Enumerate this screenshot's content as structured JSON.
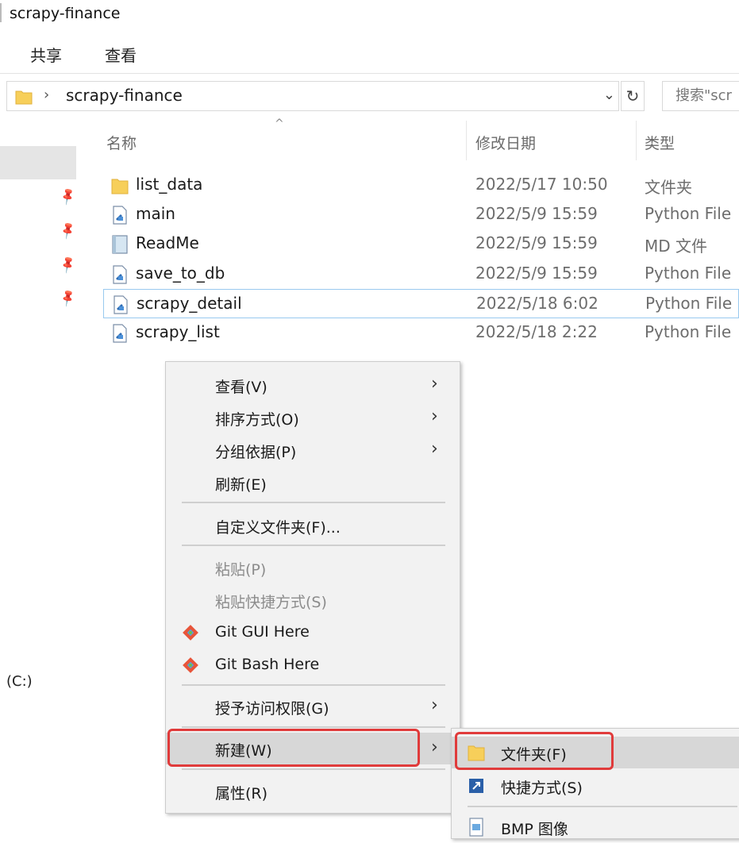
{
  "window": {
    "title": "scrapy-finance"
  },
  "ribbon": {
    "tabs": [
      "共享",
      "查看"
    ]
  },
  "address": {
    "path": "scrapy-finance",
    "search_placeholder": "搜索\"scr"
  },
  "nav": {
    "drive_label": "(C:)"
  },
  "columns": {
    "name": "名称",
    "date": "修改日期",
    "type": "类型"
  },
  "files": [
    {
      "name": "list_data",
      "date": "2022/5/17 10:50",
      "type": "文件夹",
      "icon": "folder-icon"
    },
    {
      "name": "main",
      "date": "2022/5/9 15:59",
      "type": "Python File",
      "icon": "python-file-icon"
    },
    {
      "name": "ReadMe",
      "date": "2022/5/9 15:59",
      "type": "MD 文件",
      "icon": "markdown-file-icon"
    },
    {
      "name": "save_to_db",
      "date": "2022/5/9 15:59",
      "type": "Python File",
      "icon": "python-file-icon"
    },
    {
      "name": "scrapy_detail",
      "date": "2022/5/18 6:02",
      "type": "Python File",
      "icon": "python-file-icon"
    },
    {
      "name": "scrapy_list",
      "date": "2022/5/18 2:22",
      "type": "Python File",
      "icon": "python-file-icon"
    }
  ],
  "context_menu": {
    "view": "查看(V)",
    "sort": "排序方式(O)",
    "group": "分组依据(P)",
    "refresh": "刷新(E)",
    "customize": "自定义文件夹(F)...",
    "paste": "粘贴(P)",
    "paste_shortcut": "粘贴快捷方式(S)",
    "git_gui": "Git GUI Here",
    "git_bash": "Git Bash Here",
    "give_access": "授予访问权限(G)",
    "new": "新建(W)",
    "properties": "属性(R)"
  },
  "submenu": {
    "folder": "文件夹(F)",
    "shortcut": "快捷方式(S)",
    "bmp": "BMP 图像"
  },
  "colors": {
    "highlight_box": "#e03b3b",
    "selection_border": "#99c9ef",
    "folder": "#f7cf5a",
    "menu_bg": "#f2f2f2"
  }
}
